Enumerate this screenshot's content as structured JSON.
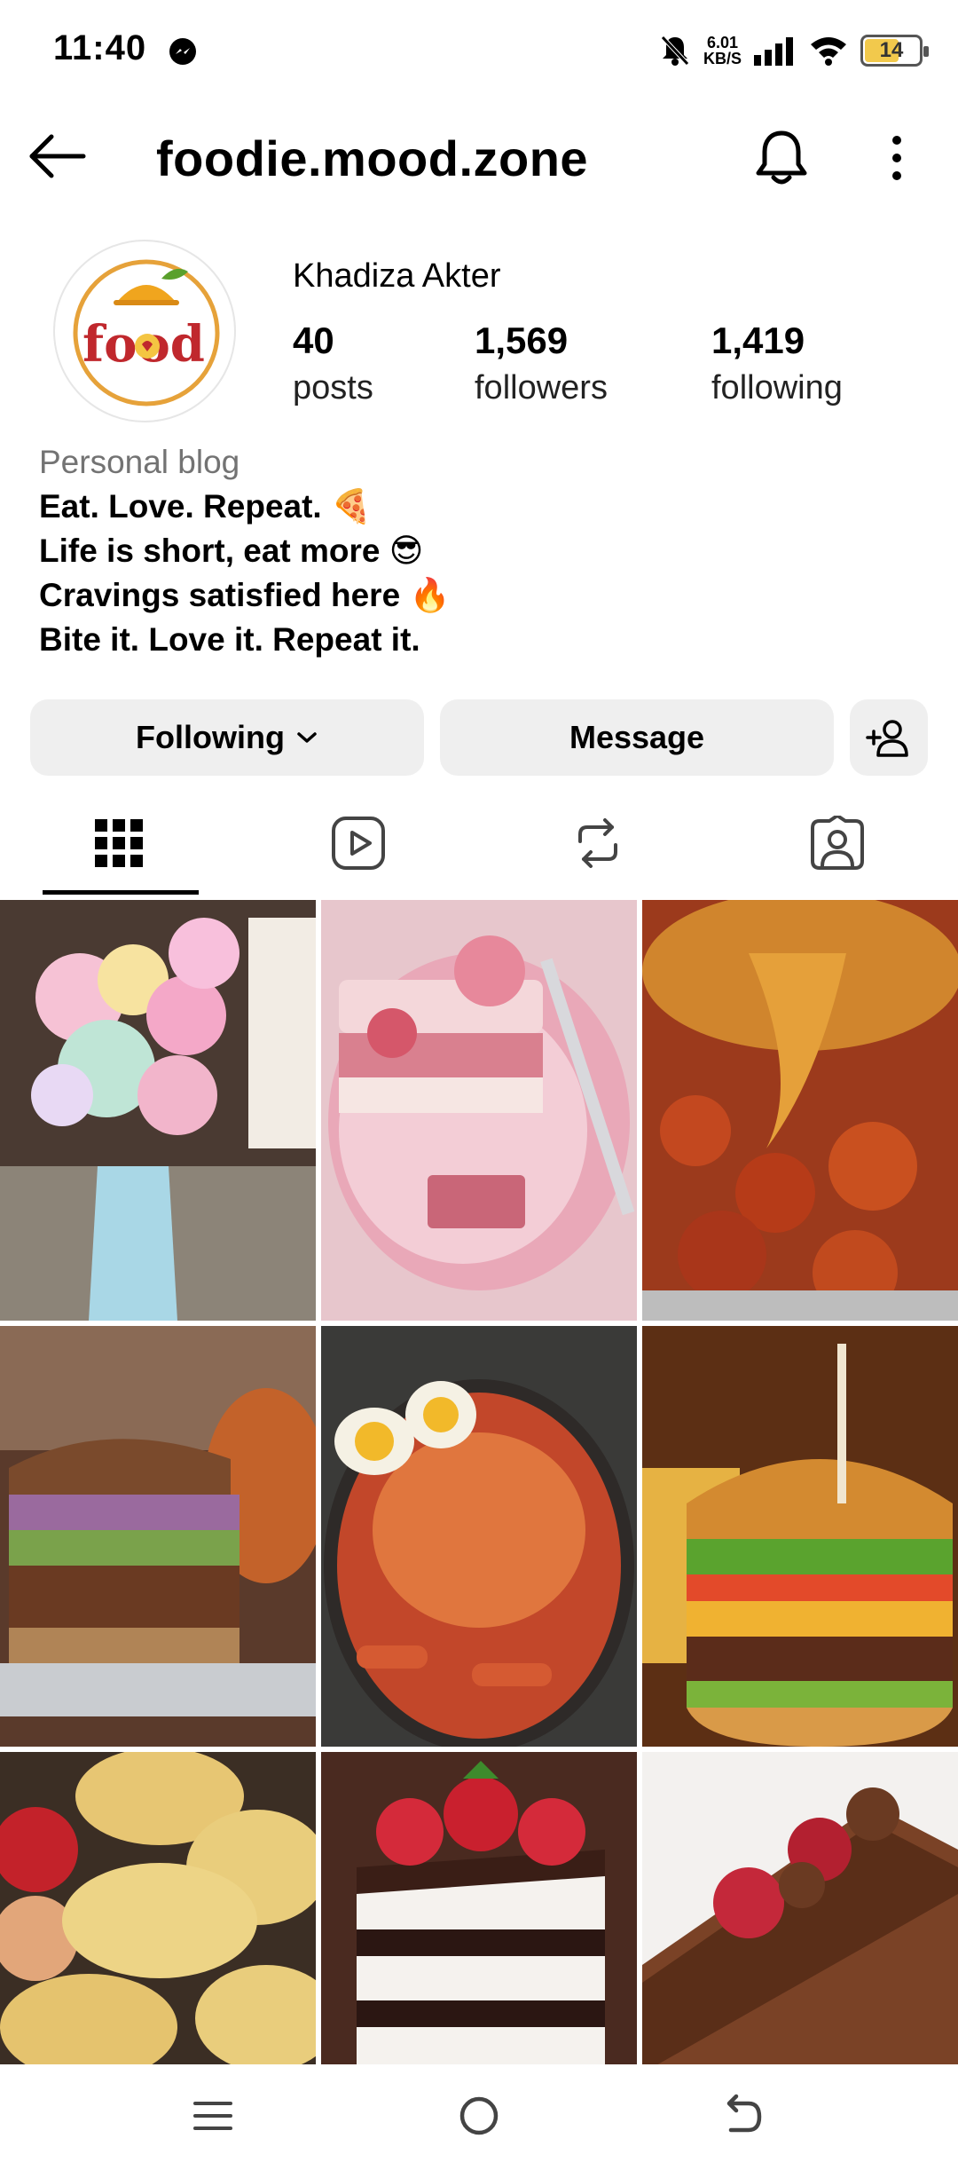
{
  "status_bar": {
    "time": "11:40",
    "net_speed_value": "6.01",
    "net_speed_unit": "KB/S",
    "battery": "14"
  },
  "header": {
    "username": "foodie.mood.zone"
  },
  "profile": {
    "avatar_logo_text": "food",
    "display_name": "Khadiza Akter",
    "stats": [
      {
        "value": "40",
        "label": "posts"
      },
      {
        "value": "1,569",
        "label": "followers"
      },
      {
        "value": "1,419",
        "label": "following"
      }
    ],
    "category": "Personal blog",
    "bio_lines": [
      "Eat. Love. Repeat. 🍕",
      "Life is short, eat more 😎",
      "Cravings satisfied here 🔥",
      "Bite it. Love it. Repeat it."
    ]
  },
  "actions": {
    "following_label": "Following",
    "message_label": "Message"
  },
  "tabs": [
    "grid-icon",
    "reels-icon",
    "reposts-icon",
    "tagged-icon"
  ],
  "grid_posts": [
    {
      "name": "post-candy-milkshake",
      "bg": "#c9a7b6",
      "accent": "#f4b8d0"
    },
    {
      "name": "post-pink-cake-plate",
      "bg": "#e9b9c6",
      "accent": "#f6dde4"
    },
    {
      "name": "post-crawfish-noodles",
      "bg": "#b8451f",
      "accent": "#e08c2e"
    },
    {
      "name": "post-slaw-burger",
      "bg": "#6b3f2a",
      "accent": "#c66a2e"
    },
    {
      "name": "post-spicy-ramen-tteokbokki",
      "bg": "#c2472a",
      "accent": "#e3733f"
    },
    {
      "name": "post-cheeseburger",
      "bg": "#7a4520",
      "accent": "#e7a83b"
    },
    {
      "name": "post-garlic-bread",
      "bg": "#c79a52",
      "accent": "#f0d48b"
    },
    {
      "name": "post-strawberry-cake",
      "bg": "#4a2b22",
      "accent": "#d42a3a"
    },
    {
      "name": "post-chocolate-roll",
      "bg": "#6b3a22",
      "accent": "#c4283a"
    }
  ],
  "colors": {
    "button_bg": "#efefef",
    "muted_text": "#737373"
  }
}
